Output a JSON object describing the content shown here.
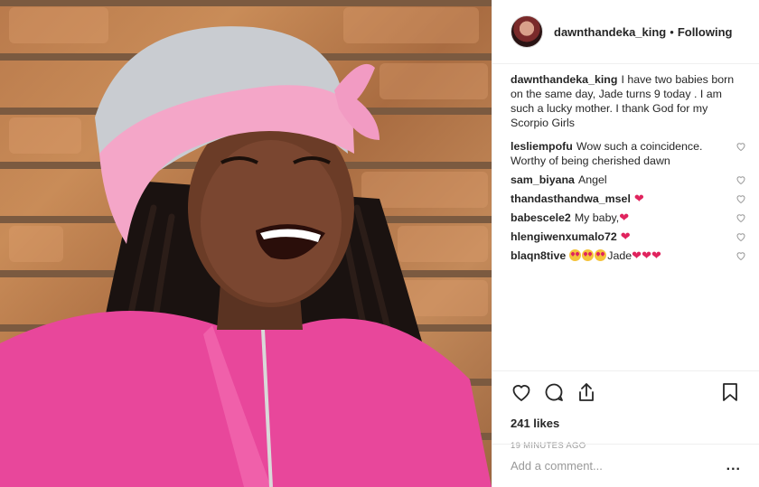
{
  "post": {
    "username": "dawnthandeka_king",
    "follow_status": "Following",
    "caption": "I have two babies born on the same day, Jade turns 9 today . I am such a lucky mother. I thank God for my Scorpio Girls",
    "likes": "241 likes",
    "time": "19 MINUTES AGO",
    "add_comment_placeholder": "Add a comment...",
    "more": "..."
  },
  "comments": [
    {
      "user": "lesliempofu",
      "text": "Wow such a coincidence. Worthy of being cherished dawn"
    },
    {
      "user": "sam_biyana",
      "text": "Angel"
    },
    {
      "user": "thandasthandwa_msel",
      "text": "",
      "hearts": "❤"
    },
    {
      "user": "babescele2",
      "text": "My baby,",
      "hearts": "❤"
    },
    {
      "user": "hlengiwenxumalo72",
      "text": "",
      "hearts": "❤"
    },
    {
      "user": "blaqn8tive",
      "text": "Jade",
      "hearts": "❤❤❤"
    }
  ],
  "icons": {
    "like": "heart-icon",
    "comment": "comment-icon",
    "share": "share-icon",
    "save": "bookmark-icon",
    "comment_like": "heart-icon",
    "more": "more-icon"
  },
  "colors": {
    "heart": "#e0245e",
    "muted": "#999999",
    "text": "#262626"
  }
}
